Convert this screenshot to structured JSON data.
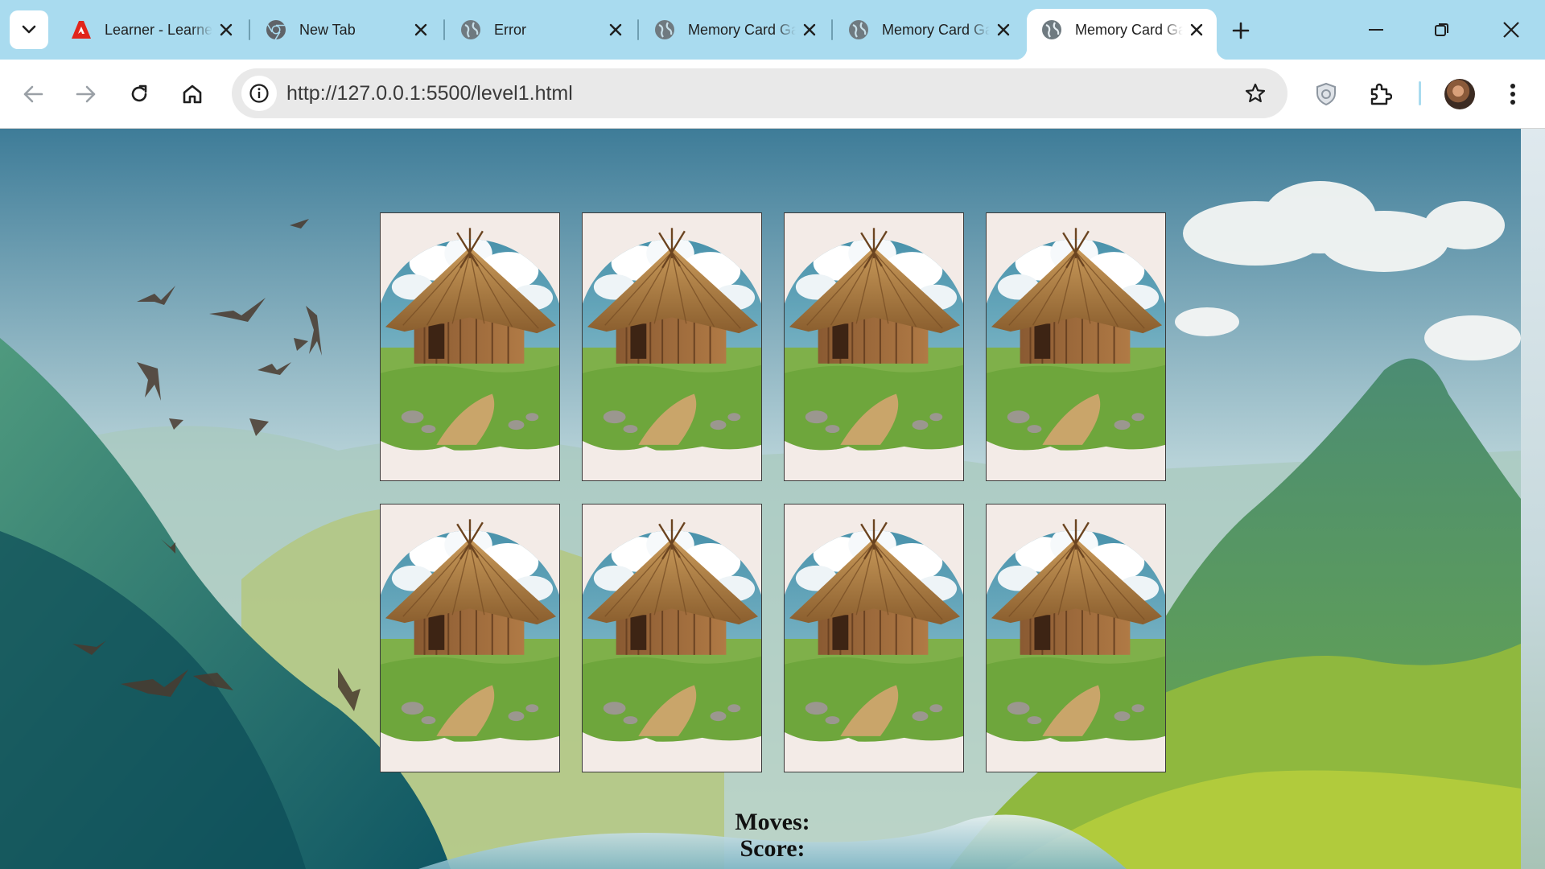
{
  "browser": {
    "tabs": [
      {
        "title": "Learner - Learner",
        "favicon": "adobe-icon"
      },
      {
        "title": "New Tab",
        "favicon": "chrome-icon"
      },
      {
        "title": "Error",
        "favicon": "globe-icon"
      },
      {
        "title": "Memory Card Game",
        "favicon": "globe-icon"
      },
      {
        "title": "Memory Card Game",
        "favicon": "globe-icon"
      },
      {
        "title": "Memory Card Game",
        "favicon": "globe-icon",
        "active": true
      }
    ],
    "url": "http://127.0.0.1:5500/level1.html"
  },
  "game": {
    "cards": [
      {
        "face": "hut-card-back"
      },
      {
        "face": "hut-card-back"
      },
      {
        "face": "hut-card-back"
      },
      {
        "face": "hut-card-back"
      },
      {
        "face": "hut-card-back"
      },
      {
        "face": "hut-card-back"
      },
      {
        "face": "hut-card-back"
      },
      {
        "face": "hut-card-back"
      }
    ],
    "moves_label": "Moves:",
    "score_label": "Score:"
  },
  "colors": {
    "tab_strip": "#a9dbef",
    "card_background": "#f3ebe7"
  }
}
